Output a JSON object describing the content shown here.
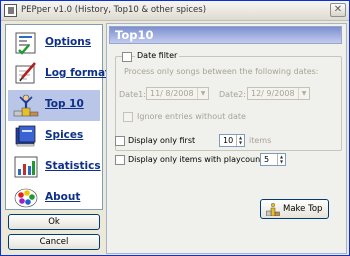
{
  "window": {
    "title": "PEPper v1.0 (History, Top10 & other spices)",
    "close_glyph": "✕"
  },
  "nav": [
    {
      "label": "Options",
      "icon": "options-page-icon"
    },
    {
      "label": "Log format",
      "icon": "pen-notepad-icon"
    },
    {
      "label": "Top 10",
      "icon": "winner-podium-icon",
      "active": true
    },
    {
      "label": "Spices",
      "icon": "spices-book-icon"
    },
    {
      "label": "Statistics",
      "icon": "statistics-chart-icon"
    },
    {
      "label": "About",
      "icon": "color-wheel-icon"
    }
  ],
  "buttons": {
    "ok": "Ok",
    "cancel": "Cancel",
    "make_top": "Make Top"
  },
  "main": {
    "title": "Top10",
    "date_filter": {
      "label": "Date filter",
      "hint": "Process only songs between the following dates:",
      "date1_label": "Date1:",
      "date1_value": "11/ 8/2008",
      "date2_label": "Date2:",
      "date2_value": "12/ 9/2008",
      "ignore_label": "Ignore entries without date"
    },
    "display_first": {
      "label": "Display only first",
      "value": "10",
      "suffix": "items"
    },
    "display_playcount": {
      "label": "Display only items with playcount >=",
      "value": "5"
    }
  }
}
